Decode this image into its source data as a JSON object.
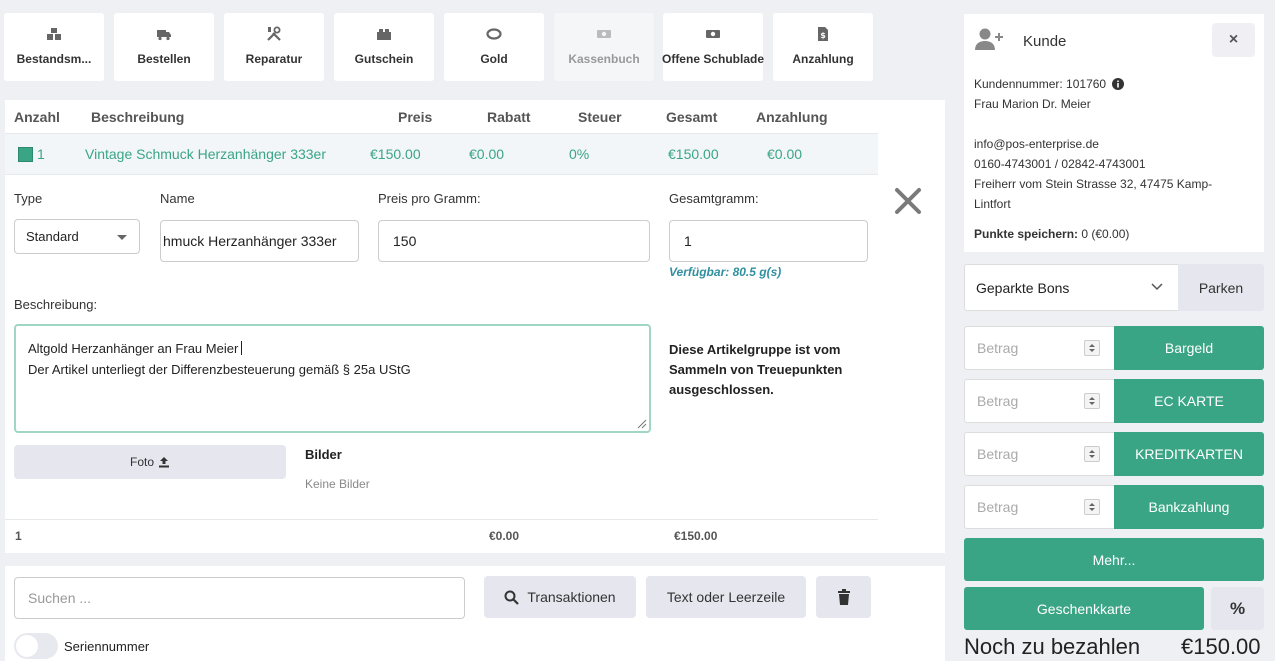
{
  "toolbar": {
    "bestand": "Bestandsm...",
    "bestellen": "Bestellen",
    "reparatur": "Reparatur",
    "gutschein": "Gutschein",
    "gold": "Gold",
    "kassenbuch": "Kassenbuch",
    "schublade": "Offene Schublade",
    "anzahlung": "Anzahlung"
  },
  "table": {
    "headers": [
      "Anzahl",
      "Beschreibung",
      "Preis",
      "Rabatt",
      "Steuer",
      "Gesamt",
      "Anzahlung"
    ],
    "row": {
      "qty": "1",
      "description": "Vintage Schmuck Herzanhänger 333er",
      "price": "€150.00",
      "discount": "€0.00",
      "tax": "0%",
      "total": "€150.00",
      "deposit": "€0.00"
    },
    "footer": {
      "qty": "1",
      "discount": "€0.00",
      "total": "€150.00"
    }
  },
  "editor": {
    "type_label": "Type",
    "type_value": "Standard",
    "name_label": "Name",
    "name_value": "hmuck Herzanhänger 333er",
    "price_label": "Preis pro Gramm:",
    "price_value": "150",
    "grams_label": "Gesamtgramm:",
    "grams_value": "1",
    "available": "Verfügbar: 80.5 g(s)",
    "desc_label": "Beschreibung:",
    "desc_line1": "Altgold Herzanhänger an Frau Meier",
    "desc_line2": "Der Artikel unterliegt der Differenzbesteuerung gemäß § 25a UStG",
    "loyalty_note": "Diese Artikelgruppe ist vom Sammeln von Treuepunkten ausgeschlossen.",
    "photo_button": "Foto",
    "images_title": "Bilder",
    "images_empty": "Keine Bilder"
  },
  "search": {
    "placeholder": "Suchen ...",
    "transactions": "Transaktionen",
    "text_line": "Text oder Leerzeile",
    "serial_label": "Seriennummer"
  },
  "customer": {
    "title": "Kunde",
    "number": "Kundennummer: 101760",
    "name": "Frau Marion Dr. Meier",
    "email": "info@pos-enterprise.de",
    "phone": "0160-4743001 / 02842-4743001",
    "address_line1": "Freiherr vom Stein Strasse 32, 47475 Kamp-",
    "address_line2": "Lintfort",
    "points_label": "Punkte speichern:",
    "points_value": "0 (€0.00)"
  },
  "parked": {
    "select": "Geparkte Bons",
    "park_button": "Parken"
  },
  "payments": {
    "placeholder": "Betrag",
    "cash": "Bargeld",
    "ec": "EC KARTE",
    "credit": "KREDITKARTEN",
    "bank": "Bankzahlung",
    "more": "Mehr...",
    "gift": "Geschenkkarte",
    "percent": "%"
  },
  "due": {
    "label": "Noch zu bezahlen",
    "amount": "€150.00"
  },
  "colors": {
    "accent": "#3aa585",
    "available": "#2f8fa0"
  }
}
